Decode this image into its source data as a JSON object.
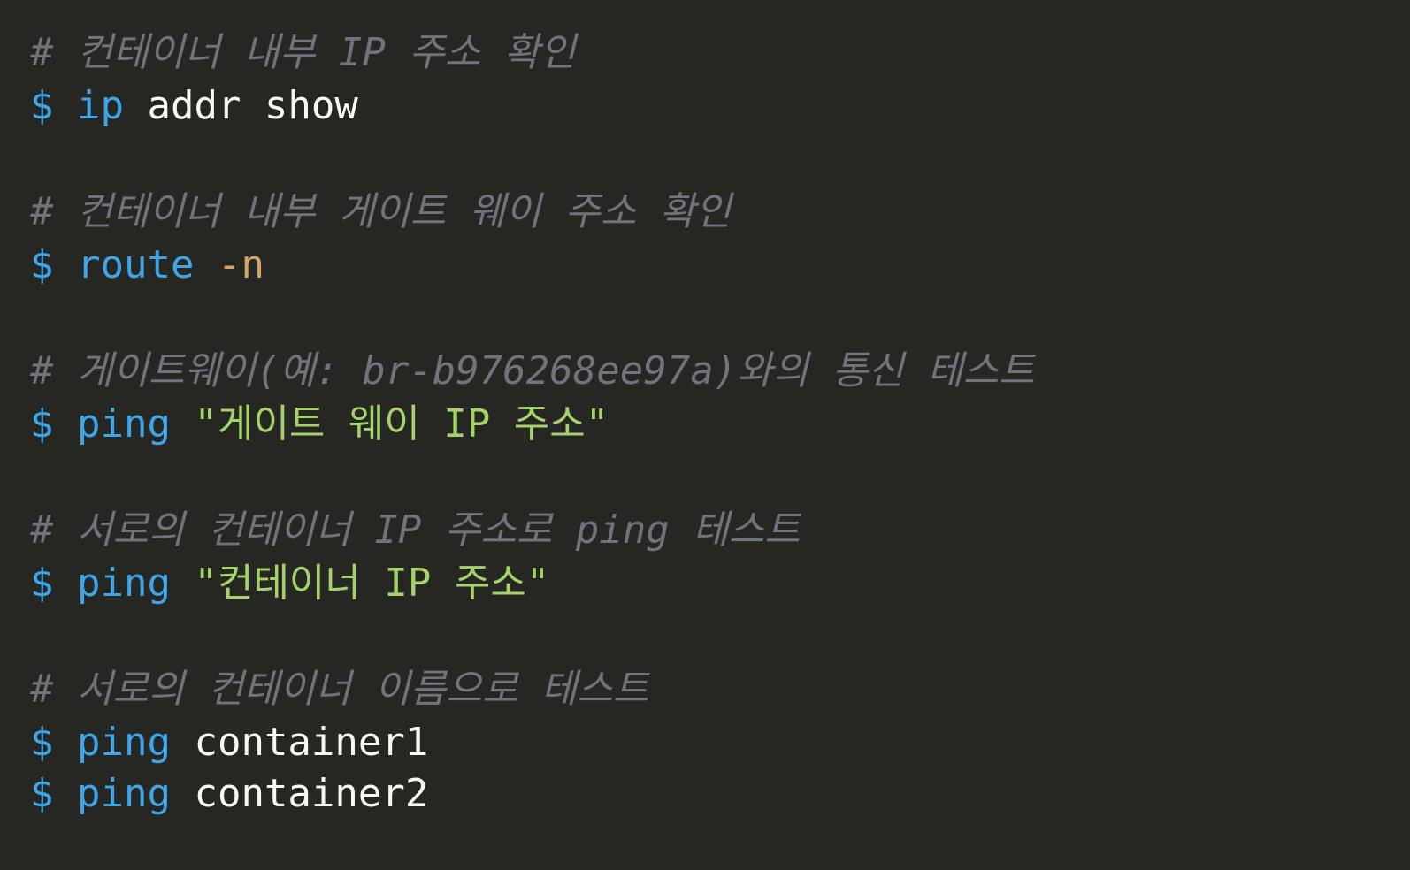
{
  "colors": {
    "background": "#262622",
    "comment": "#6f747c",
    "prompt": "#3ca6e8",
    "command": "#3ca6e8",
    "argument": "#f8f8f2",
    "flag": "#d4a56a",
    "string": "#a4d36c"
  },
  "code": {
    "prompt": "$",
    "blocks": [
      {
        "comment": "# 컨테이너 내부 IP 주소 확인",
        "commands": [
          {
            "cmd": "ip",
            "args": "addr show"
          }
        ]
      },
      {
        "comment": "# 컨테이너 내부 게이트 웨이 주소 확인",
        "commands": [
          {
            "cmd": "route",
            "flag": "-n"
          }
        ]
      },
      {
        "comment": "# 게이트웨이(예: br-b976268ee97a)와의 통신 테스트",
        "commands": [
          {
            "cmd": "ping",
            "string": "\"게이트 웨이 IP 주소\""
          }
        ]
      },
      {
        "comment": "# 서로의 컨테이너 IP 주소로 ping 테스트",
        "commands": [
          {
            "cmd": "ping",
            "string": "\"컨테이너 IP 주소\""
          }
        ]
      },
      {
        "comment": "# 서로의 컨테이너 이름으로 테스트",
        "commands": [
          {
            "cmd": "ping",
            "args": "container1"
          },
          {
            "cmd": "ping",
            "args": "container2"
          }
        ]
      }
    ]
  }
}
